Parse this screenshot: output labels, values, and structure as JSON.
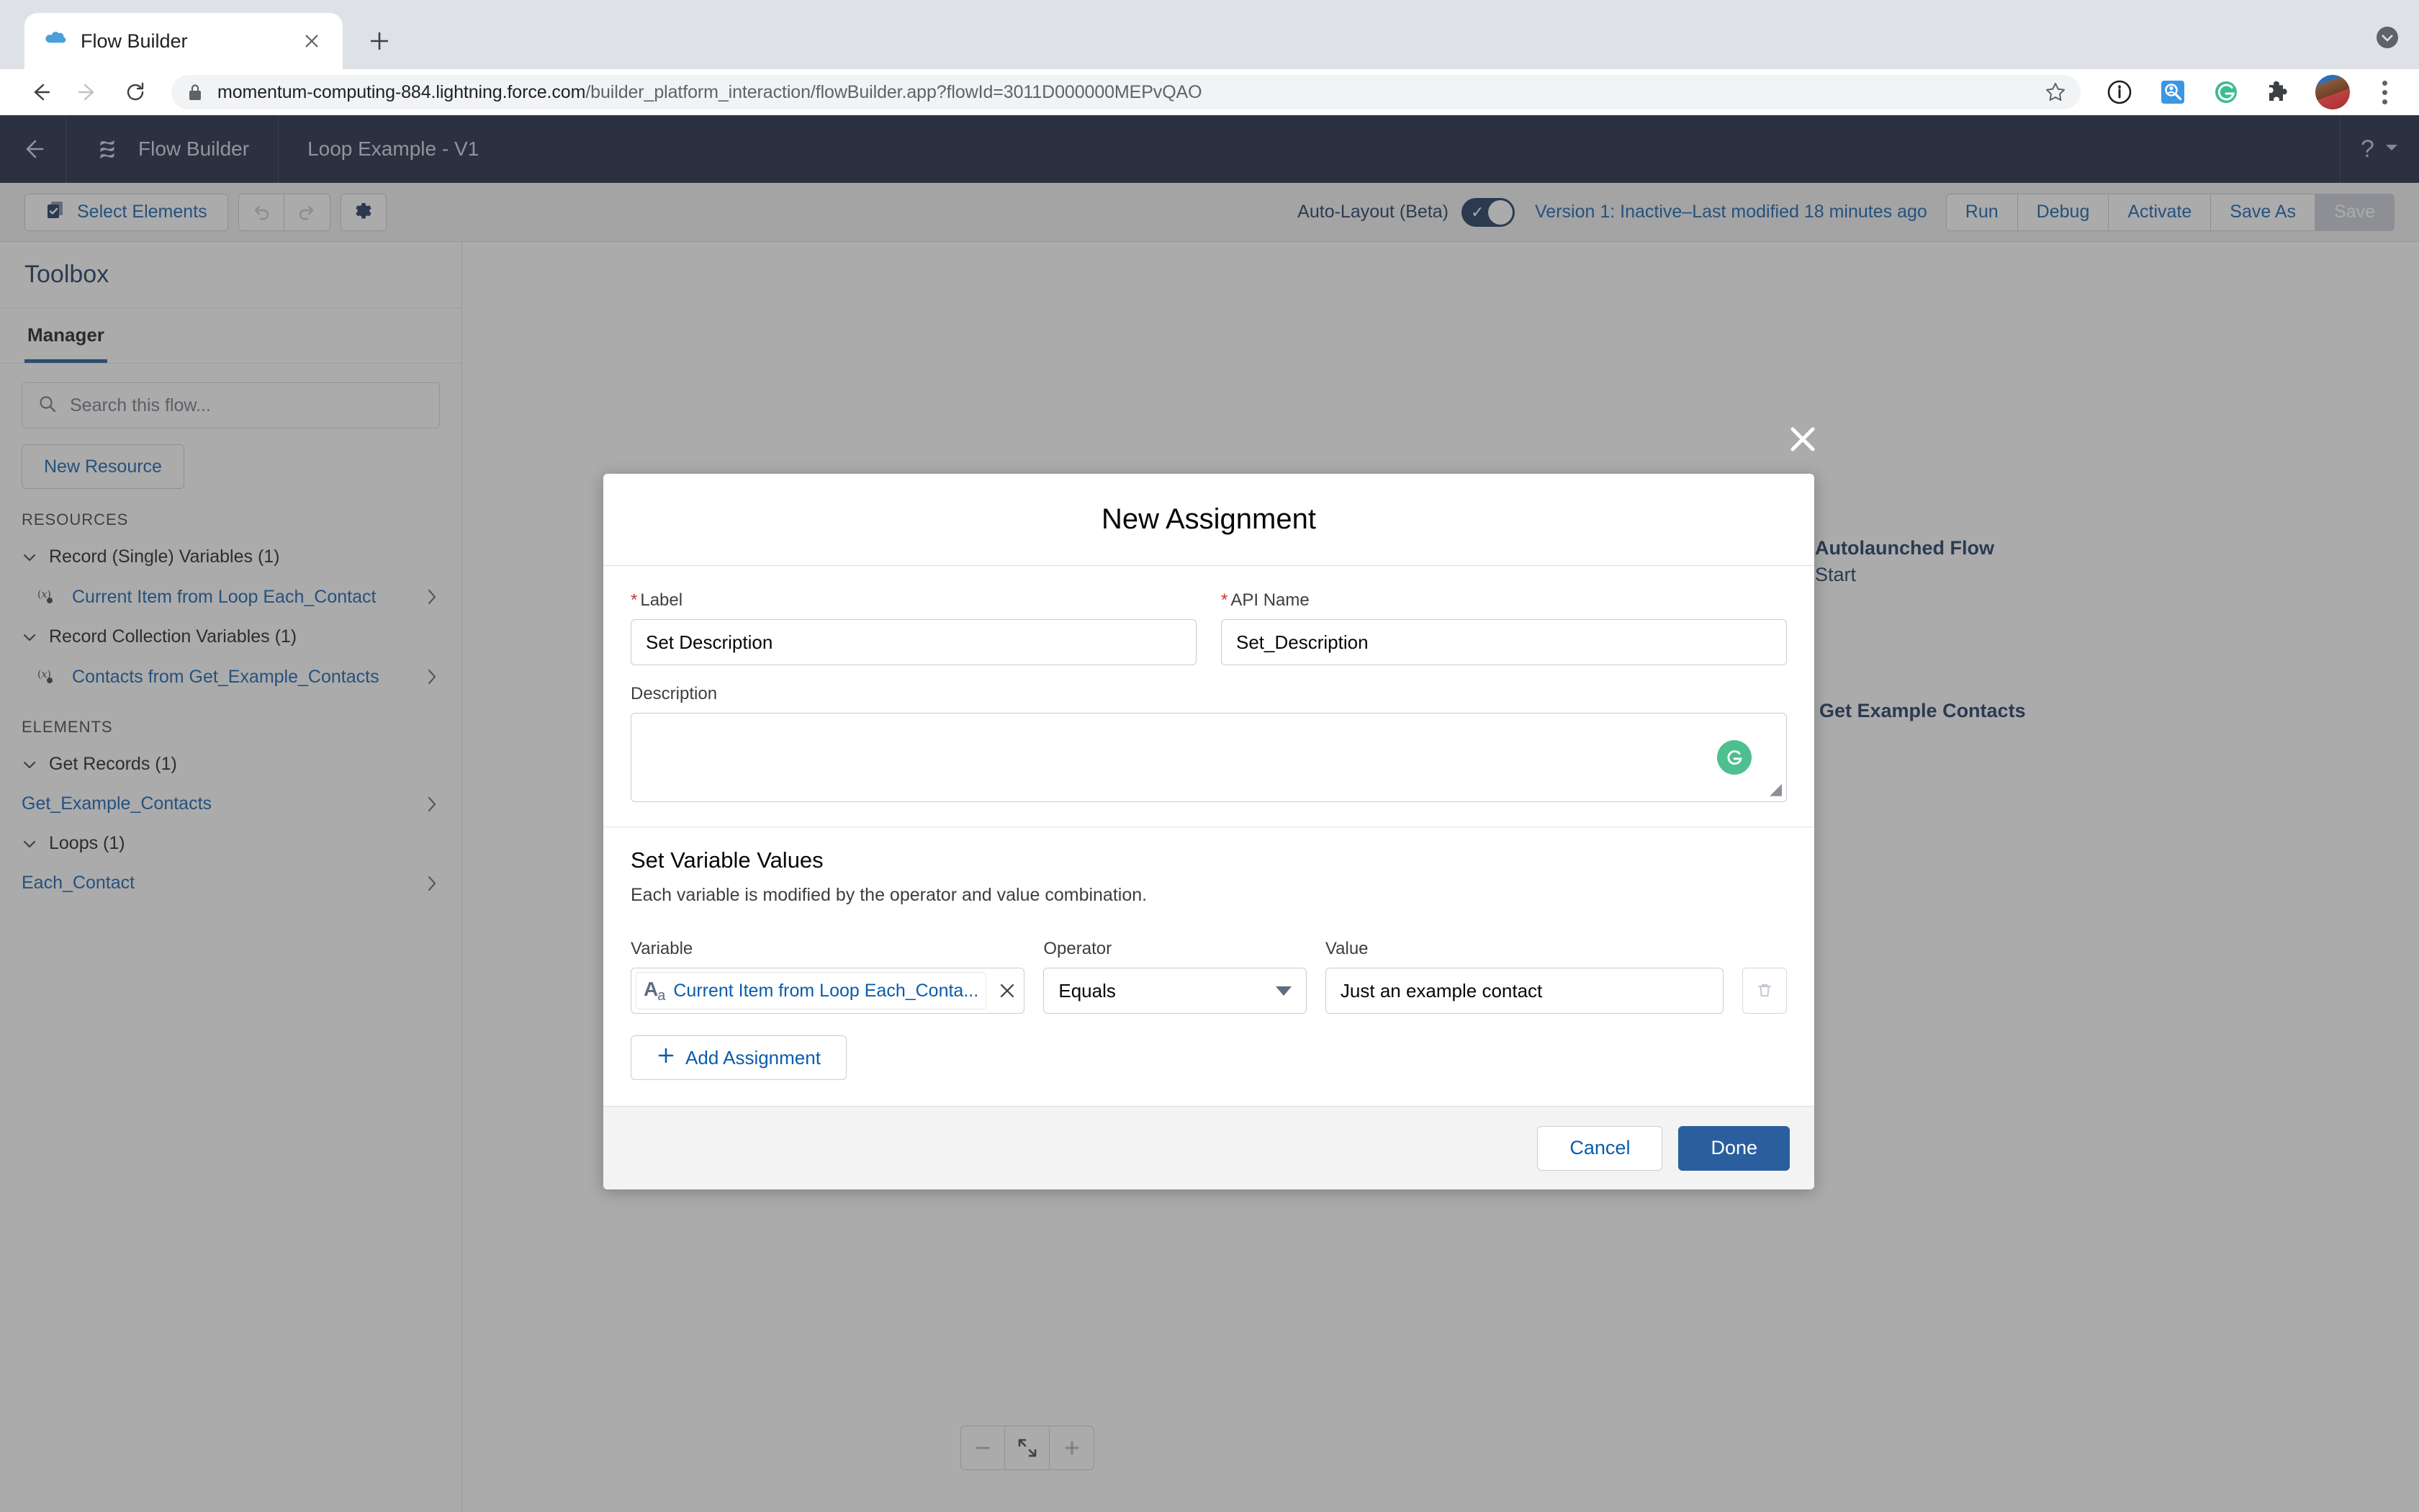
{
  "browser": {
    "tab": {
      "title": "Flow Builder",
      "favicon_icon": "salesforce-cloud-icon",
      "close_icon": "close-icon"
    },
    "new_tab_icon": "plus-icon",
    "tabstrip_menu_icon": "chevron-down-circle-icon",
    "nav": {
      "back_icon": "arrow-left-icon",
      "forward_icon": "arrow-right-icon",
      "reload_icon": "reload-icon"
    },
    "omnibox": {
      "lock_icon": "lock-icon",
      "url_host": "momentum-computing-884.lightning.force.com",
      "url_path": "/builder_platform_interaction/flowBuilder.app?flowId=3011D000000MEPvQAO",
      "star_icon": "star-icon"
    },
    "extensions": [
      {
        "name": "info-circle-icon"
      },
      {
        "name": "record-search-icon"
      },
      {
        "name": "grammarly-icon"
      },
      {
        "name": "puzzle-extensions-icon"
      },
      {
        "name": "avatar"
      }
    ],
    "menu_icon": "kebab-menu-icon"
  },
  "header": {
    "back_icon": "arrow-left-icon",
    "app_icon": "flow-builder-icon",
    "app_name": "Flow Builder",
    "flow_name": "Loop Example - V1",
    "help_icon": "question-mark-icon",
    "help_caret_icon": "chevron-down-icon"
  },
  "toolbar": {
    "select_elements_label": "Select Elements",
    "select_elements_icon": "select-elements-icon",
    "undo_icon": "undo-icon",
    "redo_icon": "redo-icon",
    "settings_icon": "gear-icon",
    "autolayout_label": "Auto-Layout (Beta)",
    "autolayout_on": true,
    "autolayout_check_icon": "check-icon",
    "version_status": "Version 1: Inactive–Last modified 18 minutes ago",
    "run_label": "Run",
    "debug_label": "Debug",
    "activate_label": "Activate",
    "save_as_label": "Save As",
    "save_label": "Save"
  },
  "toolbox": {
    "title": "Toolbox",
    "tab_manager": "Manager",
    "search_placeholder": "Search this flow...",
    "search_icon": "search-icon",
    "new_resource_label": "New Resource",
    "resources_header": "RESOURCES",
    "elements_header": "ELEMENTS",
    "resource_groups": [
      {
        "label": "Record (Single) Variables (1)",
        "items": [
          {
            "label": "Current Item from Loop Each_Contact",
            "icon": "variable-icon"
          }
        ]
      },
      {
        "label": "Record Collection Variables (1)",
        "items": [
          {
            "label": "Contacts from Get_Example_Contacts",
            "icon": "variable-icon"
          }
        ]
      }
    ],
    "element_groups": [
      {
        "label": "Get Records (1)",
        "items": [
          {
            "label": "Get_Example_Contacts"
          }
        ]
      },
      {
        "label": "Loops (1)",
        "items": [
          {
            "label": "Each_Contact"
          }
        ]
      }
    ]
  },
  "canvas": {
    "start_node": {
      "title": "Autolaunched Flow",
      "subtitle": "Start",
      "icon": "play-icon",
      "color": "#3b7d7d"
    },
    "connector_add_icon": "plus-icon",
    "second_node": {
      "title": "Get Example Contacts",
      "color": "#a8385a"
    },
    "zoom_out_icon": "minus-icon",
    "zoom_fit_icon": "fit-to-view-icon",
    "zoom_in_icon": "plus-icon"
  },
  "modal": {
    "close_icon": "close-icon",
    "title": "New Assignment",
    "label_field": {
      "label": "Label",
      "required": true,
      "value": "Set Description"
    },
    "api_name_field": {
      "label": "API Name",
      "required": true,
      "value": "Set_Description"
    },
    "description_field": {
      "label": "Description",
      "value": "",
      "assistant_icon": "grammarly-icon"
    },
    "section": {
      "title": "Set Variable Values",
      "subtitle": "Each variable is modified by the operator and value combination."
    },
    "columns": {
      "variable": "Variable",
      "operator": "Operator",
      "value": "Value"
    },
    "row": {
      "variable_icon": "text-type-icon",
      "variable_value": "Current Item from Loop Each_Conta...",
      "clear_icon": "close-icon",
      "operator_value": "Equals",
      "operator_caret_icon": "chevron-down-icon",
      "value_value": "Just an example contact",
      "delete_icon": "trash-icon"
    },
    "add_assignment_label": "Add Assignment",
    "add_assignment_icon": "plus-icon",
    "cancel_label": "Cancel",
    "done_label": "Done"
  },
  "colors": {
    "accent": "#2a5e9e",
    "header_bg": "#16213d",
    "link": "#0b5cab",
    "required": "#c23934"
  }
}
